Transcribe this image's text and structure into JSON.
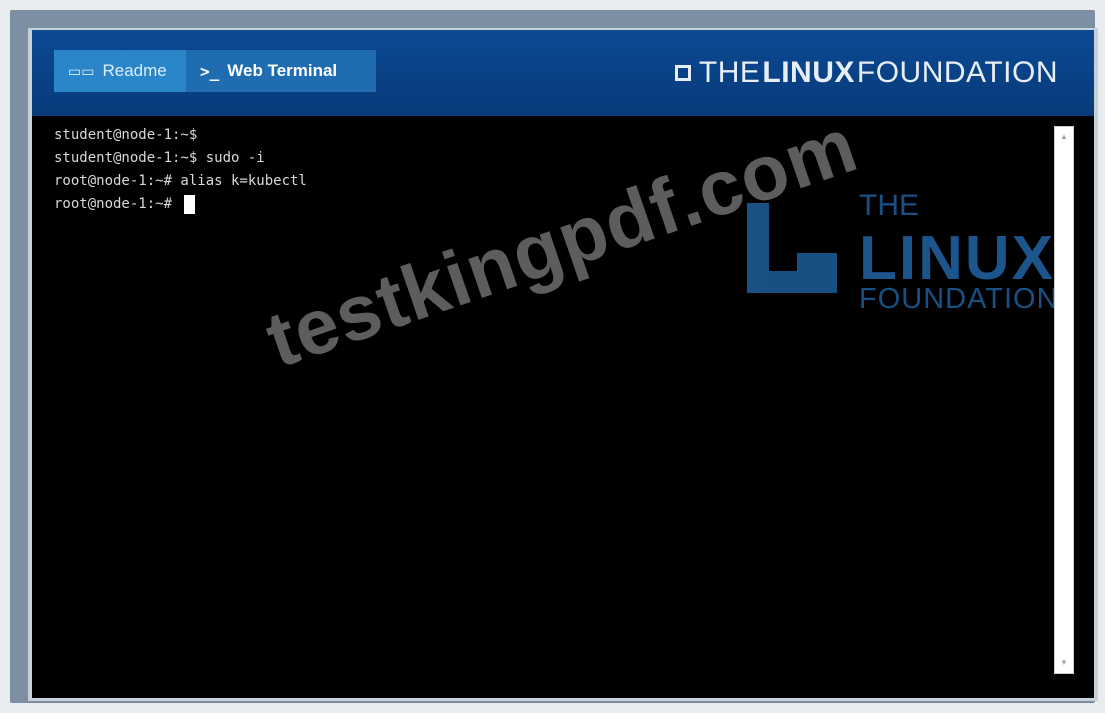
{
  "header": {
    "tabs": [
      {
        "label": "Readme",
        "icon": "book-icon"
      },
      {
        "label": "Web Terminal",
        "icon": ">_"
      }
    ],
    "brand": {
      "pre": "THE",
      "bold": "LINUX",
      "post": "FOUNDATION"
    }
  },
  "terminal": {
    "lines": [
      "student@node-1:~$",
      "student@node-1:~$ sudo -i",
      "root@node-1:~# alias k=kubectl",
      "root@node-1:~# "
    ]
  },
  "watermark": {
    "text": "testkingpdf.com",
    "logo": {
      "the": "THE",
      "linux": "LINUX",
      "foundation": "FOUNDATION"
    }
  },
  "colors": {
    "header": "#0b4a93",
    "tab_active": "#1f6cb0",
    "terminal_bg": "#000000"
  }
}
